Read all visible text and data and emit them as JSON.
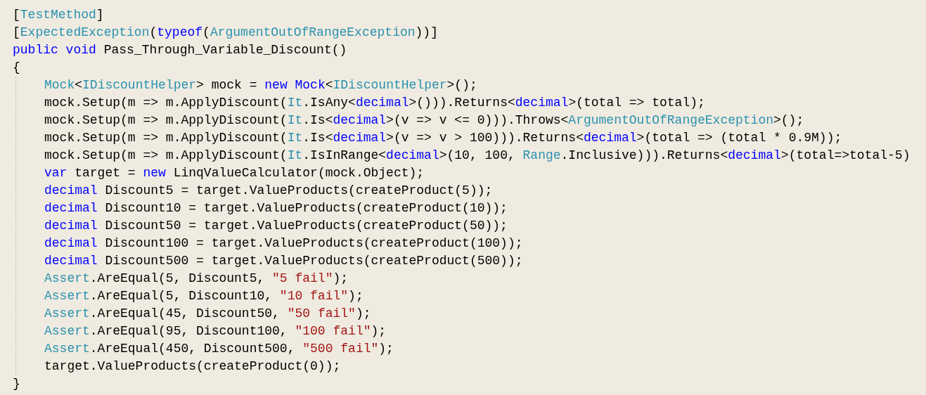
{
  "editor": {
    "header": [
      [
        {
          "kind": "plain",
          "text": "["
        },
        {
          "kind": "type",
          "text": "TestMethod"
        },
        {
          "kind": "plain",
          "text": "]"
        }
      ],
      [
        {
          "kind": "plain",
          "text": "["
        },
        {
          "kind": "type",
          "text": "ExpectedException"
        },
        {
          "kind": "plain",
          "text": "("
        },
        {
          "kind": "keyword",
          "text": "typeof"
        },
        {
          "kind": "plain",
          "text": "("
        },
        {
          "kind": "type",
          "text": "ArgumentOutOfRangeException"
        },
        {
          "kind": "plain",
          "text": "))]"
        }
      ],
      [
        {
          "kind": "keyword",
          "text": "public void"
        },
        {
          "kind": "plain",
          "text": " Pass_Through_Variable_Discount()"
        }
      ],
      [
        {
          "kind": "plain",
          "text": "{"
        }
      ]
    ],
    "body": [
      [
        {
          "kind": "type",
          "text": "Mock"
        },
        {
          "kind": "plain",
          "text": "<"
        },
        {
          "kind": "type",
          "text": "IDiscountHelper"
        },
        {
          "kind": "plain",
          "text": "> mock = "
        },
        {
          "kind": "keyword",
          "text": "new Mock"
        },
        {
          "kind": "plain",
          "text": "<"
        },
        {
          "kind": "type",
          "text": "IDiscountHelper"
        },
        {
          "kind": "plain",
          "text": ">();"
        }
      ],
      [
        {
          "kind": "plain",
          "text": "mock.Setup(m => m.ApplyDiscount("
        },
        {
          "kind": "type",
          "text": "It"
        },
        {
          "kind": "plain",
          "text": ".IsAny<"
        },
        {
          "kind": "keyword",
          "text": "decimal"
        },
        {
          "kind": "plain",
          "text": ">())).Returns<"
        },
        {
          "kind": "keyword",
          "text": "decimal"
        },
        {
          "kind": "plain",
          "text": ">(total => total);"
        }
      ],
      [
        {
          "kind": "plain",
          "text": "mock.Setup(m => m.ApplyDiscount("
        },
        {
          "kind": "type",
          "text": "It"
        },
        {
          "kind": "plain",
          "text": ".Is<"
        },
        {
          "kind": "keyword",
          "text": "decimal"
        },
        {
          "kind": "plain",
          "text": ">(v => v <= 0))).Throws<"
        },
        {
          "kind": "type",
          "text": "ArgumentOutOfRangeException"
        },
        {
          "kind": "plain",
          "text": ">();"
        }
      ],
      [
        {
          "kind": "plain",
          "text": "mock.Setup(m => m.ApplyDiscount("
        },
        {
          "kind": "type",
          "text": "It"
        },
        {
          "kind": "plain",
          "text": ".Is<"
        },
        {
          "kind": "keyword",
          "text": "decimal"
        },
        {
          "kind": "plain",
          "text": ">(v => v > 100))).Returns<"
        },
        {
          "kind": "keyword",
          "text": "decimal"
        },
        {
          "kind": "plain",
          "text": ">(total => (total * 0.9M));"
        }
      ],
      [
        {
          "kind": "plain",
          "text": "mock.Setup(m => m.ApplyDiscount("
        },
        {
          "kind": "type",
          "text": "It"
        },
        {
          "kind": "plain",
          "text": ".IsInRange<"
        },
        {
          "kind": "keyword",
          "text": "decimal"
        },
        {
          "kind": "plain",
          "text": ">(10, 100, "
        },
        {
          "kind": "type",
          "text": "Range"
        },
        {
          "kind": "plain",
          "text": ".Inclusive))).Returns<"
        },
        {
          "kind": "keyword",
          "text": "decimal"
        },
        {
          "kind": "plain",
          "text": ">(total=>total-5)"
        }
      ],
      [
        {
          "kind": "keyword",
          "text": "var"
        },
        {
          "kind": "plain",
          "text": " target = "
        },
        {
          "kind": "keyword",
          "text": "new"
        },
        {
          "kind": "plain",
          "text": " LinqValueCalculator(mock.Object);"
        }
      ],
      [
        {
          "kind": "keyword",
          "text": "decimal"
        },
        {
          "kind": "plain",
          "text": " Discount5 = target.ValueProducts(createProduct(5));"
        }
      ],
      [
        {
          "kind": "keyword",
          "text": "decimal"
        },
        {
          "kind": "plain",
          "text": " Discount10 = target.ValueProducts(createProduct(10));"
        }
      ],
      [
        {
          "kind": "keyword",
          "text": "decimal"
        },
        {
          "kind": "plain",
          "text": " Discount50 = target.ValueProducts(createProduct(50));"
        }
      ],
      [
        {
          "kind": "keyword",
          "text": "decimal"
        },
        {
          "kind": "plain",
          "text": " Discount100 = target.ValueProducts(createProduct(100));"
        }
      ],
      [
        {
          "kind": "keyword",
          "text": "decimal"
        },
        {
          "kind": "plain",
          "text": " Discount500 = target.ValueProducts(createProduct(500));"
        }
      ],
      [
        {
          "kind": "type",
          "text": "Assert"
        },
        {
          "kind": "plain",
          "text": ".AreEqual(5, Discount5, "
        },
        {
          "kind": "string",
          "text": "\"5 fail\""
        },
        {
          "kind": "plain",
          "text": ");"
        }
      ],
      [
        {
          "kind": "type",
          "text": "Assert"
        },
        {
          "kind": "plain",
          "text": ".AreEqual(5, Discount10, "
        },
        {
          "kind": "string",
          "text": "\"10 fail\""
        },
        {
          "kind": "plain",
          "text": ");"
        }
      ],
      [
        {
          "kind": "type",
          "text": "Assert"
        },
        {
          "kind": "plain",
          "text": ".AreEqual(45, Discount50, "
        },
        {
          "kind": "string",
          "text": "\"50 fail\""
        },
        {
          "kind": "plain",
          "text": ");"
        }
      ],
      [
        {
          "kind": "type",
          "text": "Assert"
        },
        {
          "kind": "plain",
          "text": ".AreEqual(95, Discount100, "
        },
        {
          "kind": "string",
          "text": "\"100 fail\""
        },
        {
          "kind": "plain",
          "text": ");"
        }
      ],
      [
        {
          "kind": "type",
          "text": "Assert"
        },
        {
          "kind": "plain",
          "text": ".AreEqual(450, Discount500, "
        },
        {
          "kind": "string",
          "text": "\"500 fail\""
        },
        {
          "kind": "plain",
          "text": ");"
        }
      ],
      [
        {
          "kind": "plain",
          "text": "target.ValueProducts(createProduct(0));"
        }
      ]
    ],
    "footer": [
      [
        {
          "kind": "plain",
          "text": "}"
        }
      ]
    ]
  }
}
